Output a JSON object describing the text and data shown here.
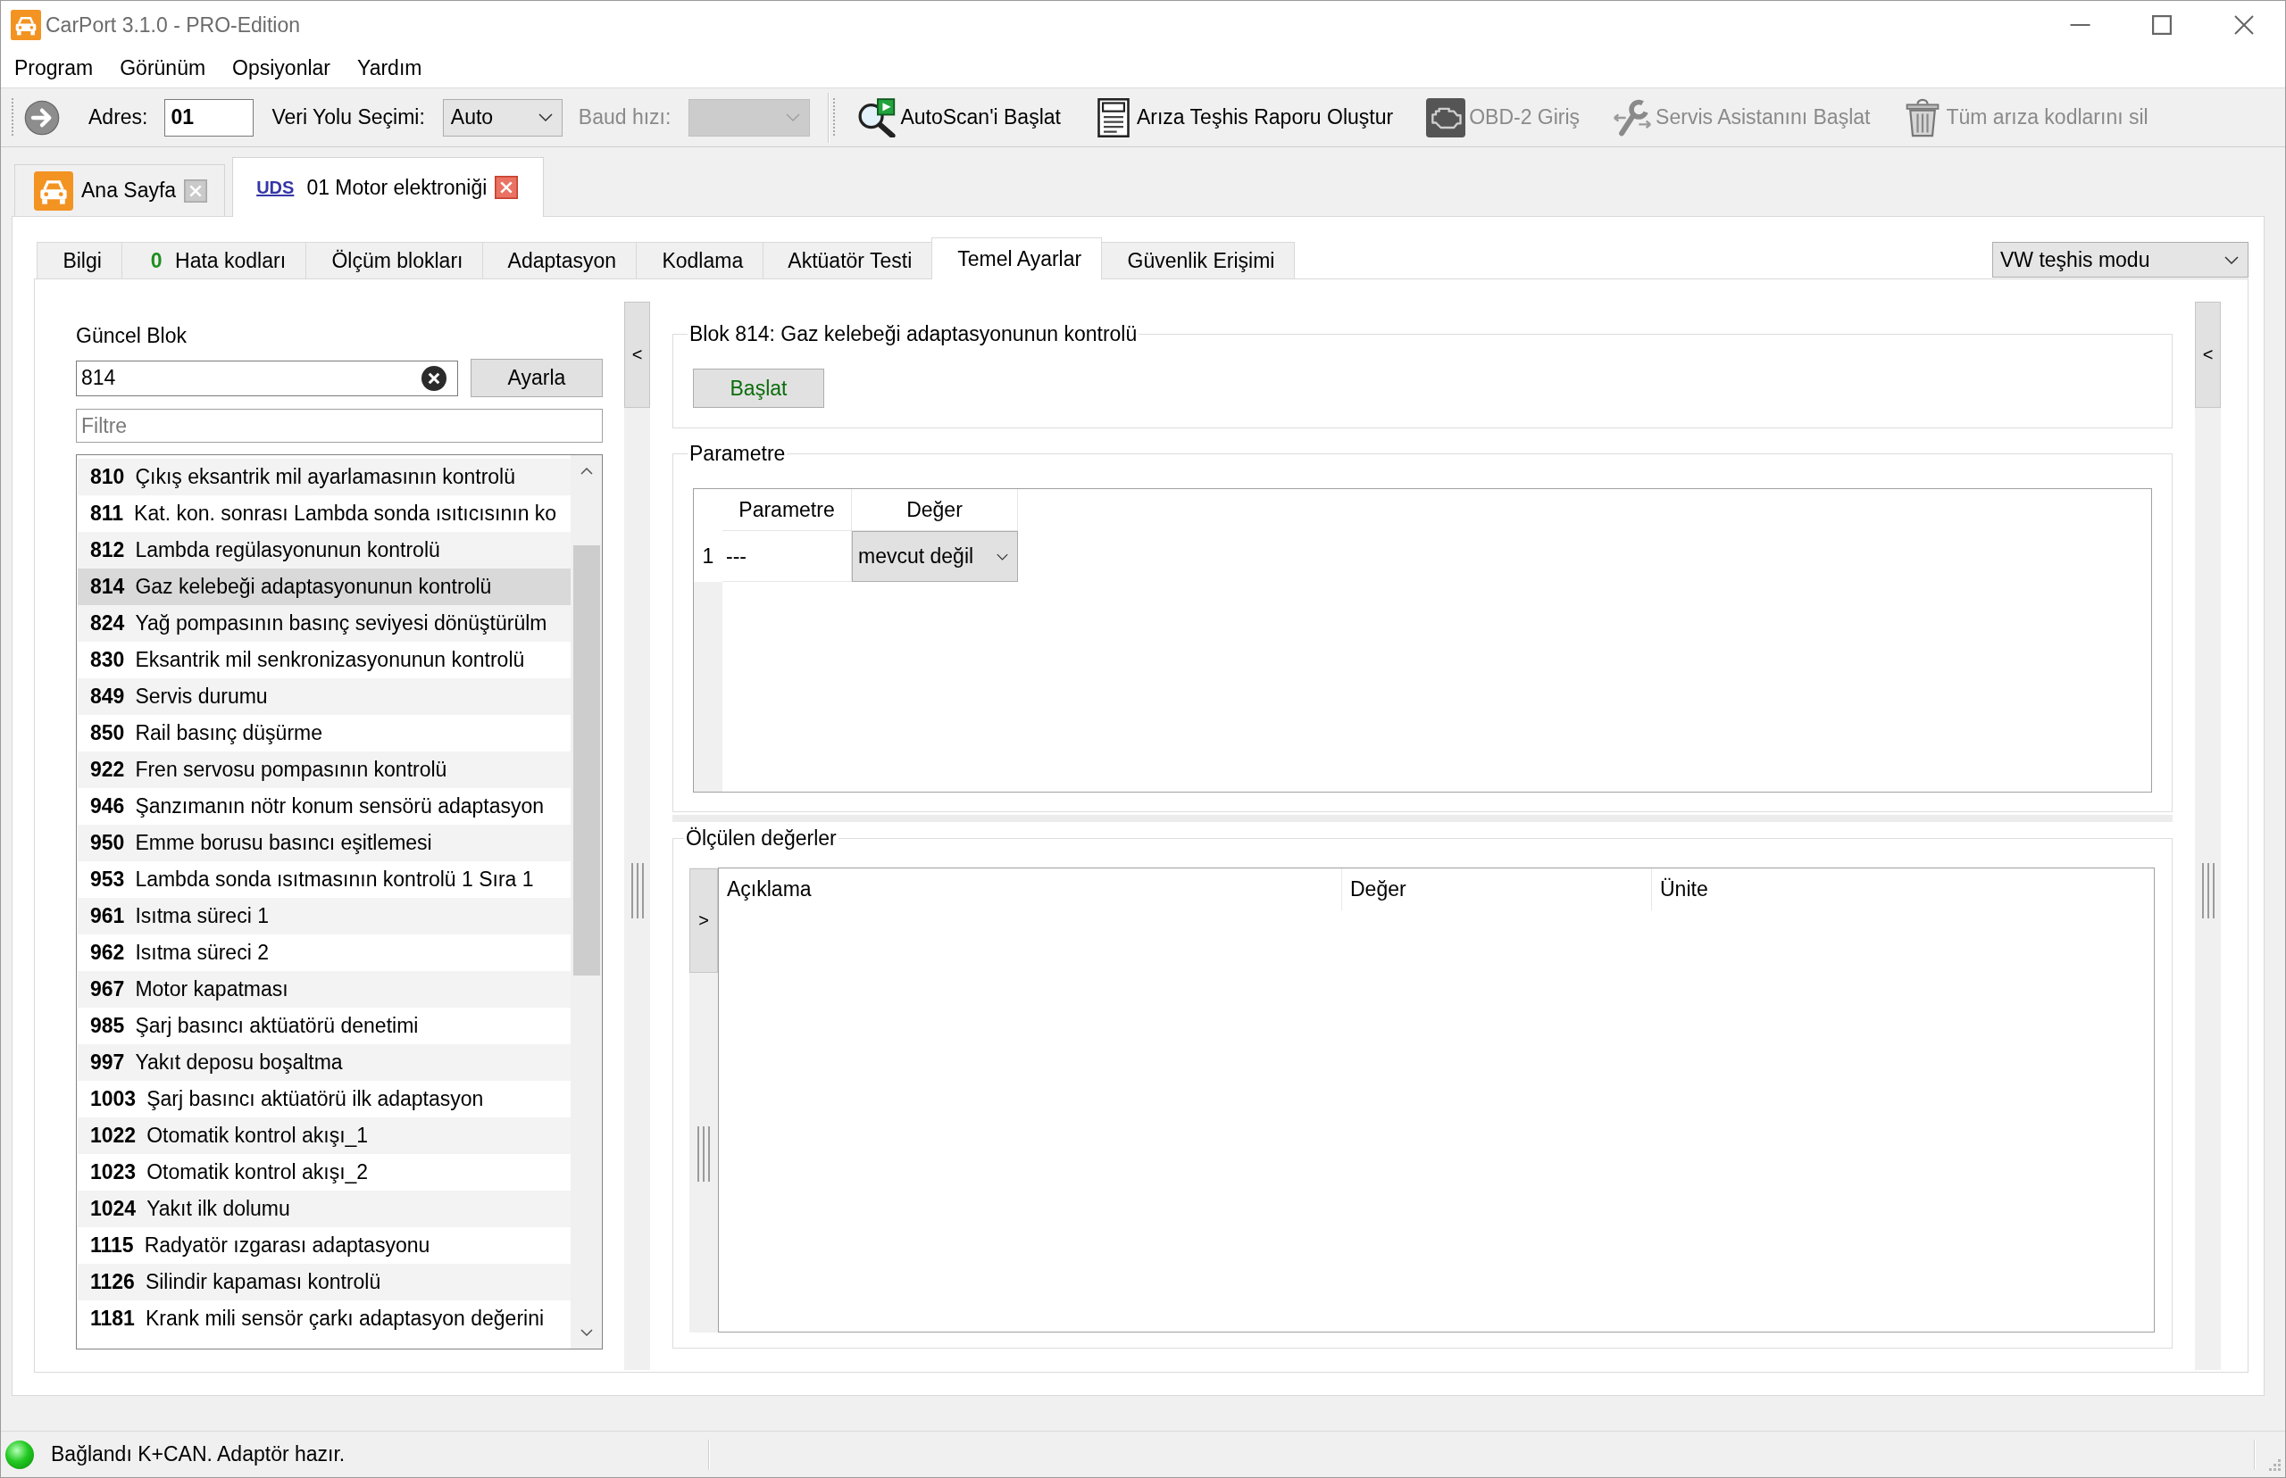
{
  "window": {
    "title": "CarPort 3.1.0 - PRO-Edition"
  },
  "menu": [
    "Program",
    "Görünüm",
    "Opsiyonlar",
    "Yardım"
  ],
  "toolbar": {
    "address": {
      "label": "Adres:",
      "value": "01"
    },
    "bus": {
      "label": "Veri Yolu Seçimi:",
      "value": "Auto"
    },
    "baud": {
      "label": "Baud hızı:",
      "disabled": true
    },
    "actions": [
      {
        "label": "AutoScan'i Başlat",
        "disabled": false
      },
      {
        "label": "Arıza Teşhis Raporu Oluştur",
        "disabled": false
      },
      {
        "label": "OBD-2 Giriş",
        "disabled": true
      },
      {
        "label": "Servis Asistanını Başlat",
        "disabled": true
      },
      {
        "label": "Tüm arıza kodlarını sil",
        "disabled": true
      }
    ]
  },
  "document_tabs": [
    {
      "kind": "home",
      "label": "Ana Sayfa",
      "selected": false
    },
    {
      "kind": "module",
      "protocol": "UDS",
      "label": "01 Motor elektroniği",
      "selected": true
    }
  ],
  "tabs": [
    {
      "label": "Bilgi",
      "selected": false
    },
    {
      "count": "0",
      "label": "Hata kodları",
      "selected": false
    },
    {
      "label": "Ölçüm blokları",
      "selected": false
    },
    {
      "label": "Adaptasyon",
      "selected": false
    },
    {
      "label": "Kodlama",
      "selected": false
    },
    {
      "label": "Aktüatör Testi",
      "selected": false
    },
    {
      "label": "Temel Ayarlar",
      "selected": true
    },
    {
      "label": "Güvenlik Erişimi",
      "selected": false
    }
  ],
  "mode_select": {
    "value": "VW teşhis modu"
  },
  "block_panel": {
    "label": "Güncel Blok",
    "block_field": {
      "value": "814"
    },
    "set_button": "Ayarla",
    "filter": {
      "placeholder": "Filtre"
    },
    "blocks": [
      {
        "number": "810",
        "name": "Çıkış eksantrik mil ayarlamasının kontrolü",
        "selected": false
      },
      {
        "number": "811",
        "name": "Kat. kon. sonrası Lambda sonda ısıtıcısının ko",
        "selected": false
      },
      {
        "number": "812",
        "name": "Lambda regülasyonunun kontrolü",
        "selected": false
      },
      {
        "number": "814",
        "name": "Gaz kelebeği adaptasyonunun kontrolü",
        "selected": true
      },
      {
        "number": "824",
        "name": "Yağ pompasının basınç seviyesi dönüştürülm",
        "selected": false
      },
      {
        "number": "830",
        "name": "Eksantrik mil senkronizasyonunun kontrolü",
        "selected": false
      },
      {
        "number": "849",
        "name": "Servis durumu",
        "selected": false
      },
      {
        "number": "850",
        "name": "Rail basınç düşürme",
        "selected": false
      },
      {
        "number": "922",
        "name": "Fren servosu pompasının kontrolü",
        "selected": false
      },
      {
        "number": "946",
        "name": "Şanzımanın nötr konum sensörü adaptasyon",
        "selected": false
      },
      {
        "number": "950",
        "name": "Emme borusu basıncı eşitlemesi",
        "selected": false
      },
      {
        "number": "953",
        "name": "Lambda sonda ısıtmasının kontrolü 1 Sıra 1",
        "selected": false
      },
      {
        "number": "961",
        "name": "Isıtma süreci 1",
        "selected": false
      },
      {
        "number": "962",
        "name": "Isıtma süreci 2",
        "selected": false
      },
      {
        "number": "967",
        "name": "Motor kapatması",
        "selected": false
      },
      {
        "number": "985",
        "name": "Şarj basıncı aktüatörü denetimi",
        "selected": false
      },
      {
        "number": "997",
        "name": "Yakıt deposu boşaltma",
        "selected": false
      },
      {
        "number": "1003",
        "name": "Şarj basıncı aktüatörü ilk adaptasyon",
        "selected": false
      },
      {
        "number": "1022",
        "name": "Otomatik kontrol akışı_1",
        "selected": false
      },
      {
        "number": "1023",
        "name": "Otomatik kontrol akışı_2",
        "selected": false
      },
      {
        "number": "1024",
        "name": "Yakıt ilk dolumu",
        "selected": false
      },
      {
        "number": "1115",
        "name": "Radyatör ızgarası adaptasyonu",
        "selected": false
      },
      {
        "number": "1126",
        "name": "Silindir kapaması kontrolü",
        "selected": false
      },
      {
        "number": "1181",
        "name": "Krank mili sensör çarkı adaptasyon değerini",
        "selected": false
      }
    ]
  },
  "left_toggle": "<",
  "block_group": {
    "title": "Blok 814: Gaz kelebeği adaptasyonunun kontrolü",
    "start_button": "Başlat"
  },
  "parameters": {
    "title": "Parametre",
    "columns": [
      "Parametre",
      "Değer"
    ],
    "rows": [
      {
        "number": "1",
        "parameter": "---",
        "value": "mevcut değil"
      }
    ]
  },
  "measured_values": {
    "title": "Ölçülen değerler",
    "toggle": ">",
    "columns": [
      "Açıklama",
      "Değer",
      "Ünite"
    ]
  },
  "right_toggle": "<",
  "status_bar": {
    "connected": true,
    "text": "Bağlandı K+CAN. Adaptör hazır."
  }
}
